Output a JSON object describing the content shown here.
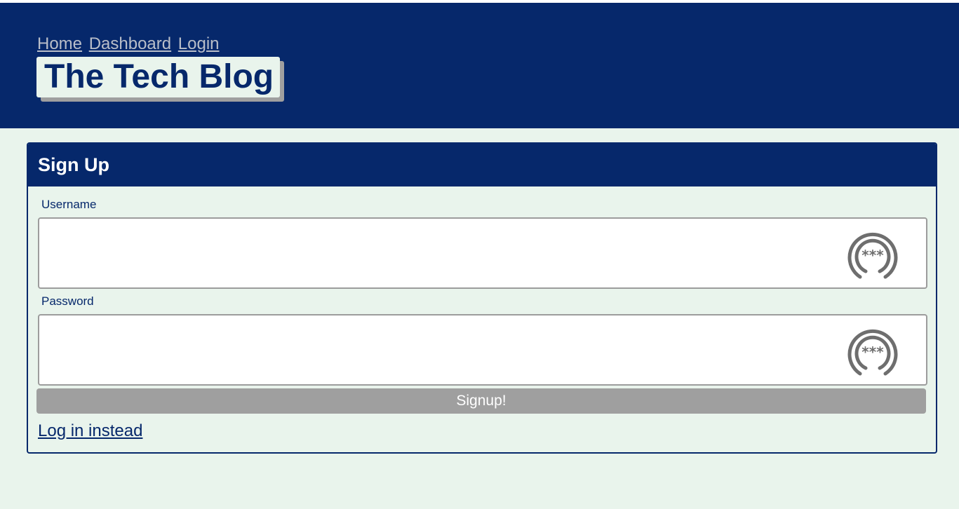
{
  "nav": {
    "items": [
      {
        "label": "Home"
      },
      {
        "label": "Dashboard"
      },
      {
        "label": "Login"
      }
    ]
  },
  "brand": {
    "title": "The Tech Blog"
  },
  "signup": {
    "title": "Sign Up",
    "username_label": "Username",
    "username_value": "",
    "password_label": "Password",
    "password_value": "",
    "submit_label": "Signup!",
    "alt_link": "Log in instead"
  },
  "colors": {
    "primary": "#06286b",
    "background": "#e9f4ec",
    "button": "#9f9f9f",
    "nav_link": "#b9bec9"
  },
  "icons": {
    "password_manager": "password-manager-icon"
  }
}
